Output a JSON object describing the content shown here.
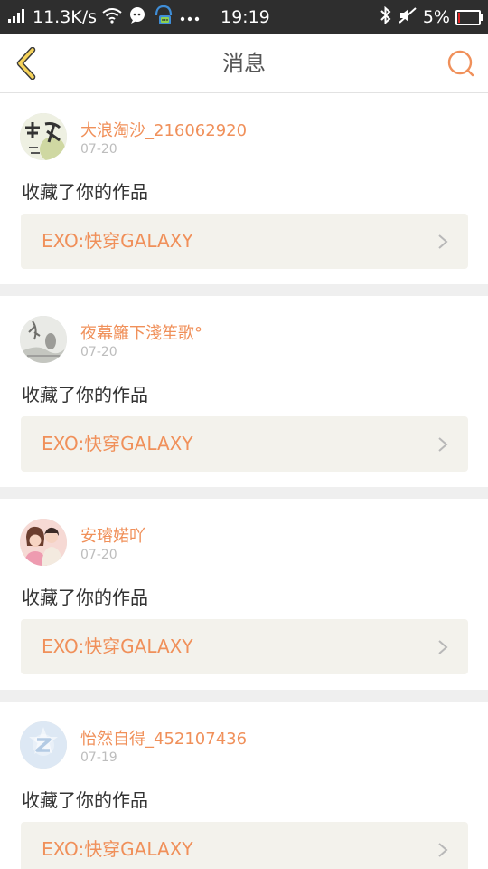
{
  "status_bar": {
    "network_speed": "11.3K/s",
    "time": "19:19",
    "battery_percent": "5%",
    "battery_level": 0.05,
    "battery_color": "#e02323"
  },
  "header": {
    "back_icon": "chevron-left-icon",
    "title": "消息",
    "search_icon": "search-icon"
  },
  "colors": {
    "accent": "#f0905a",
    "back_arrow": "#f6d35a",
    "work_box_bg": "#f3f2ec"
  },
  "messages": [
    {
      "username": "大浪淘沙_216062920",
      "date": "07-20",
      "action": "收藏了你的作品",
      "work_title": "EXO:快穿GALAXY"
    },
    {
      "username": "夜幕籬下淺笙歌°",
      "date": "07-20",
      "action": "收藏了你的作品",
      "work_title": "EXO:快穿GALAXY"
    },
    {
      "username": "安璿婼吖",
      "date": "07-20",
      "action": "收藏了你的作品",
      "work_title": "EXO:快穿GALAXY"
    },
    {
      "username": "怡然自得_452107436",
      "date": "07-19",
      "action": "收藏了你的作品",
      "work_title": "EXO:快穿GALAXY"
    }
  ]
}
